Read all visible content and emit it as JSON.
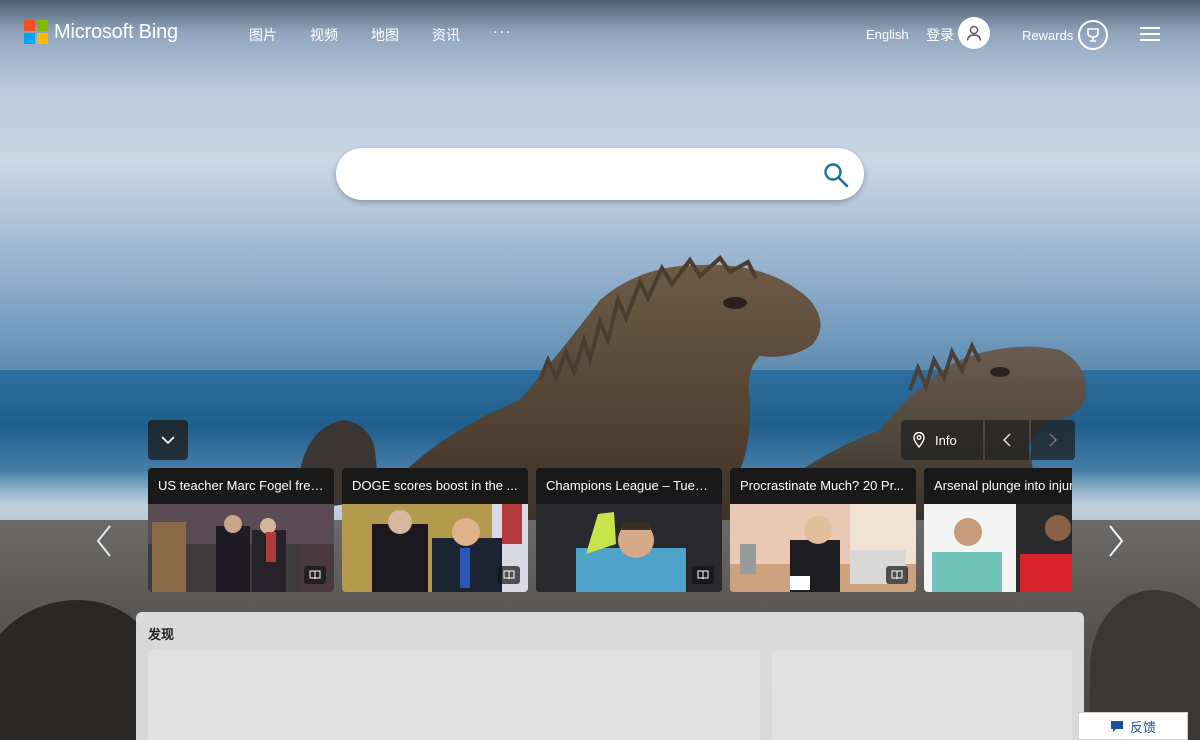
{
  "header": {
    "logo_text": "Microsoft Bing",
    "nav": [
      {
        "label": "图片"
      },
      {
        "label": "视频"
      },
      {
        "label": "地图"
      },
      {
        "label": "资讯"
      }
    ],
    "more_label": "···",
    "language": "English",
    "signin_label": "登录",
    "rewards_label": "Rewards"
  },
  "search": {
    "value": "",
    "placeholder": ""
  },
  "carousel": {
    "info_label": "Info",
    "news": [
      {
        "title": "US teacher Marc Fogel free..."
      },
      {
        "title": "DOGE scores boost in the ..."
      },
      {
        "title": "Champions League – Tues..."
      },
      {
        "title": "Procrastinate Much? 20 Pr..."
      },
      {
        "title": "Arsenal plunge into injury"
      }
    ]
  },
  "discover": {
    "title": "发现"
  },
  "feedback": {
    "label": "反馈"
  },
  "colors": {
    "search_icon": "#1a6e9c",
    "feedback_text": "#1d4e9c"
  }
}
